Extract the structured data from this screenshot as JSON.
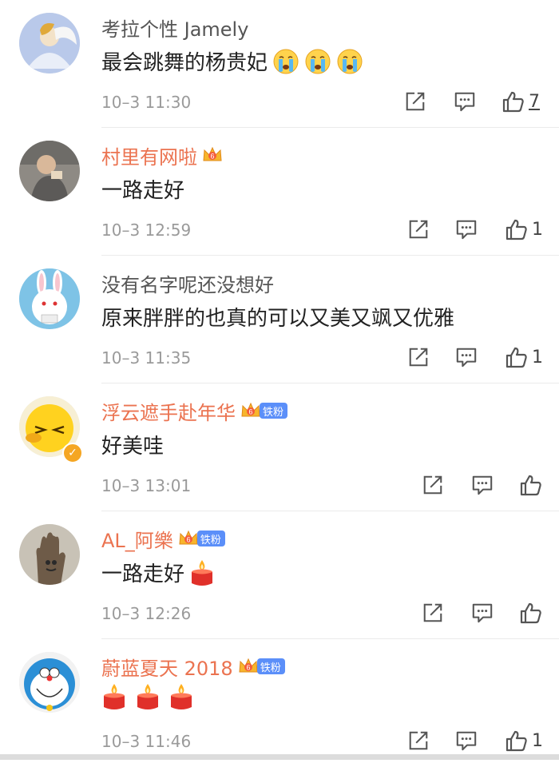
{
  "comments": [
    {
      "username": "考拉个性 Jamely",
      "text": "最会跳舞的杨贵妃",
      "time": "10–3 11:30",
      "likes": "7",
      "emojis": [
        "crying-emoji",
        "crying-emoji",
        "crying-emoji"
      ]
    },
    {
      "username": "村里有网啦",
      "text": "一路走好",
      "time": "10–3 12:59",
      "likes": "1"
    },
    {
      "username": "没有名字呢还没想好",
      "text": "原来胖胖的也真的可以又美又飒又优雅",
      "time": "10–3 11:35",
      "likes": "1"
    },
    {
      "username": "浮云遮手赴年华",
      "badge": "铁粉",
      "text": "好美哇",
      "time": "10–3 13:01",
      "likes": ""
    },
    {
      "username": "AL_阿樂",
      "badge": "铁粉",
      "text": "一路走好",
      "time": "10–3 12:26",
      "likes": "",
      "emojis": [
        "candle-emoji"
      ]
    },
    {
      "username": "蔚蓝夏天 2018",
      "badge": "铁粉",
      "text": "",
      "time": "10–3 11:46",
      "likes": "1",
      "emojis": [
        "candle-emoji",
        "candle-emoji",
        "candle-emoji"
      ]
    }
  ],
  "colors": {
    "vip_name": "#eb7350",
    "badge_blue": "#5b8ff9",
    "timestamp": "#9a9a9a"
  },
  "icons": [
    "repost-icon",
    "comment-icon",
    "like-icon",
    "crown-icon",
    "verified-icon"
  ]
}
